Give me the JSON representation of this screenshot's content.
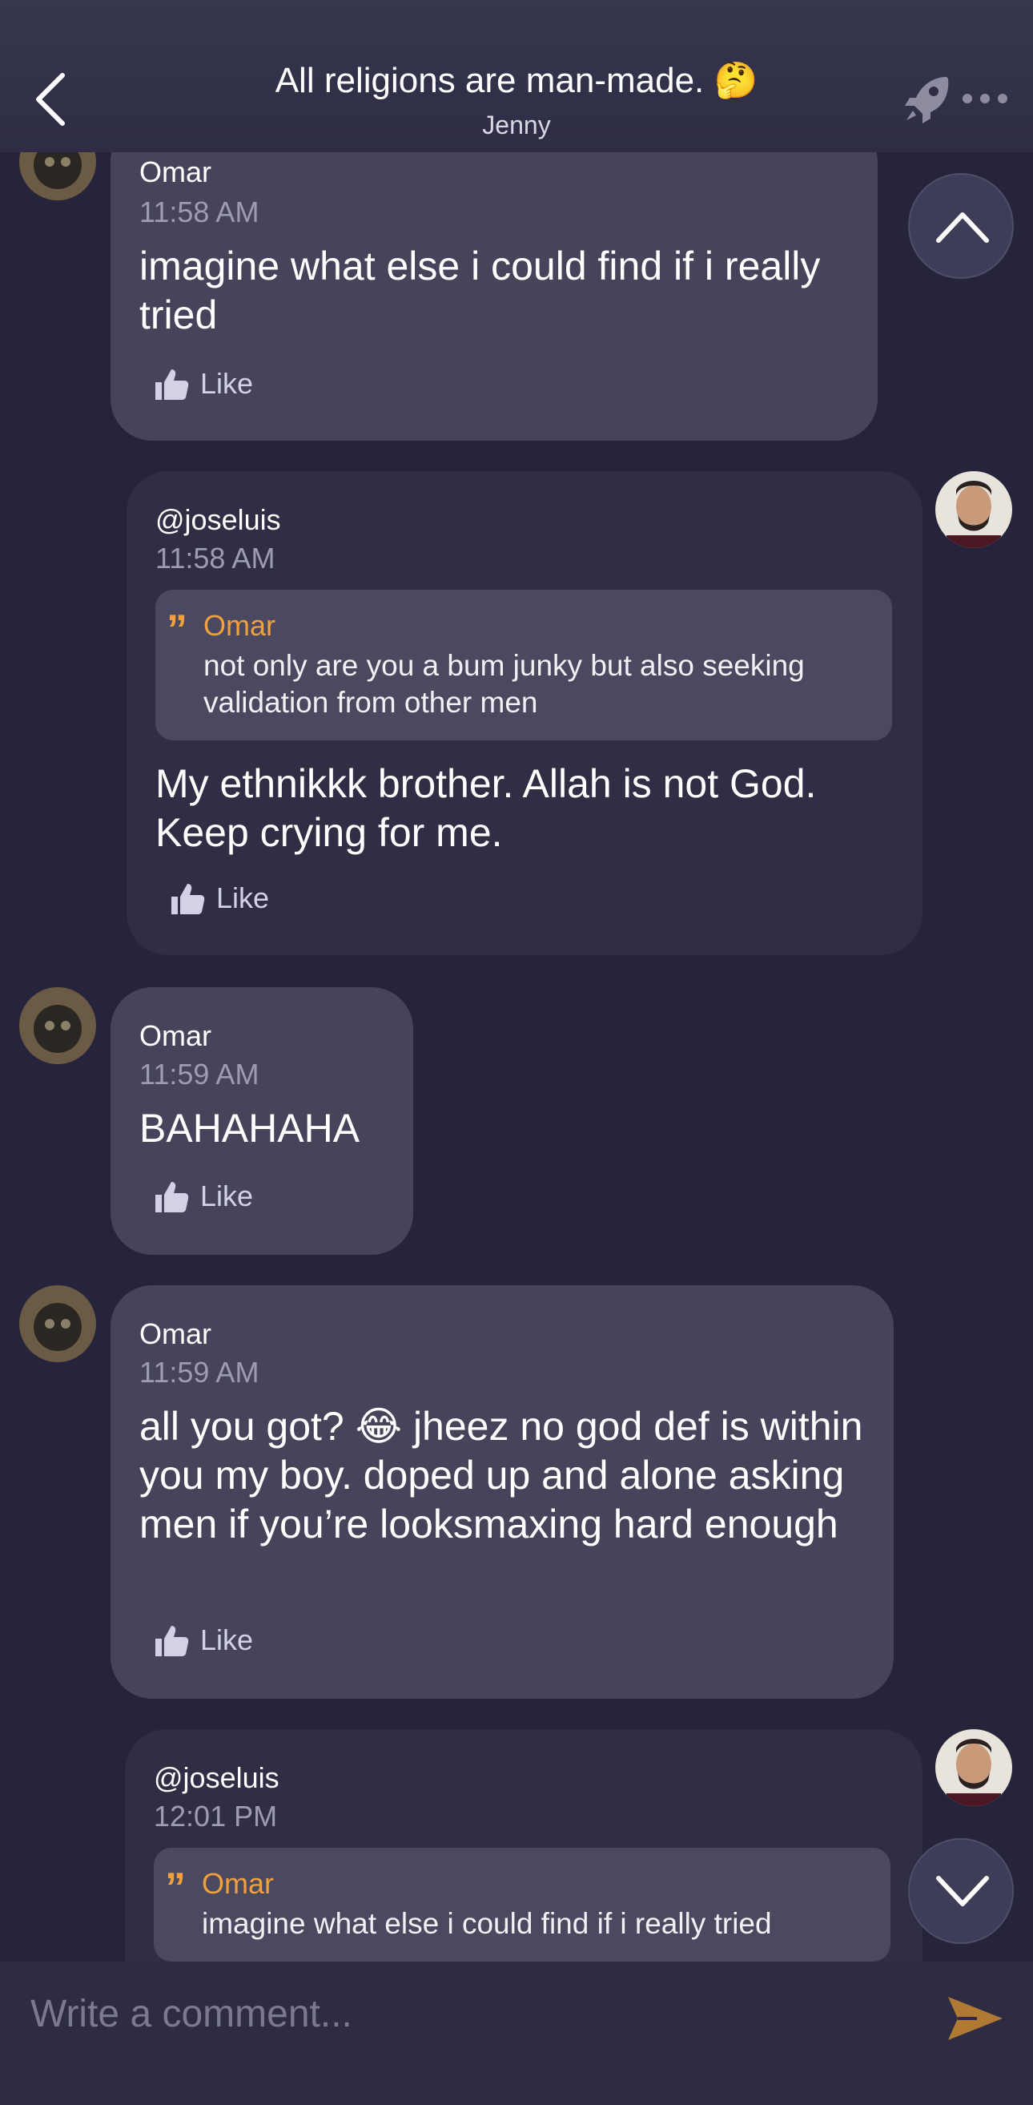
{
  "header": {
    "title": "All religions are man-made. 🤔",
    "subtitle": "Jenny"
  },
  "messages": [
    {
      "author": "Omar",
      "time": "11:58 AM",
      "body": "imagine what else i could find if i really tried",
      "like_label": "Like"
    },
    {
      "author": "@joseluis",
      "time": "11:58 AM",
      "quote": {
        "author": "Omar",
        "text": "not only are you a bum junky but also seeking validation from other men"
      },
      "body": "My ethnikkk brother. Allah is not God. Keep crying for me.",
      "like_label": "Like"
    },
    {
      "author": "Omar",
      "time": "11:59 AM",
      "body": "BAHAHAHA",
      "like_label": "Like"
    },
    {
      "author": "Omar",
      "time": "11:59 AM",
      "body": "all you got? 😂 jheez no god def is within you my boy. doped up and alone asking men if you’re looksmaxing hard enough",
      "like_label": "Like"
    },
    {
      "author": "@joseluis",
      "time": "12:01 PM",
      "quote": {
        "author": "Omar",
        "text": "imagine what else i could find if i really tried"
      }
    }
  ],
  "composer": {
    "placeholder": "Write a comment..."
  },
  "colors": {
    "accent": "#f0a03c",
    "background": "#25243a",
    "bubble_other": "#45445b",
    "bubble_self": "#2f2e45"
  },
  "icons": [
    "back-icon",
    "rocket-icon",
    "more-icon",
    "thumbs-up-icon",
    "chevron-up-icon",
    "chevron-down-icon",
    "send-icon",
    "quote-icon"
  ]
}
